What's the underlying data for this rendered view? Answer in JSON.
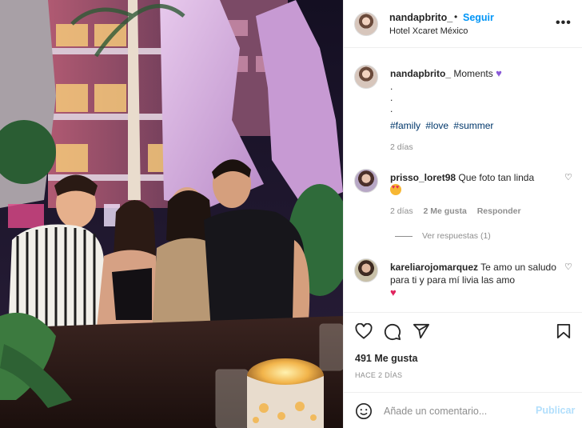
{
  "post": {
    "author": "nandapbrito_",
    "follow_label": "Seguir",
    "dot": "•",
    "location": "Hotel Xcaret México",
    "more_label": "•••"
  },
  "caption": {
    "username": "nandapbrito_",
    "text": "Moments",
    "dots": [
      ".",
      ".",
      "."
    ],
    "hashtags": [
      "#family",
      "#love",
      "#summer"
    ],
    "time": "2 días"
  },
  "comments": [
    {
      "username": "prisso_loret98",
      "text": "Que foto tan linda",
      "time": "2 días",
      "likes": "2 Me gusta",
      "reply_label": "Responder",
      "replies_label": "Ver respuestas (1)"
    },
    {
      "username": "kareliarojomarquez",
      "text": "Te amo un saludo para ti y para mí livia las amo"
    }
  ],
  "actions": {
    "likes": "491 Me gusta",
    "date": "HACE 2 DÍAS"
  },
  "add_comment": {
    "placeholder": "Añade un comentario...",
    "post_label": "Publicar"
  },
  "icons": [
    "heart-icon",
    "comment-icon",
    "share-icon",
    "bookmark-icon",
    "smiley-icon",
    "more-icon"
  ],
  "colors": {
    "link_blue": "#0095f6",
    "hashtag": "#00376b",
    "muted": "#8e8e8e",
    "post_disabled": "#b2dffc"
  }
}
